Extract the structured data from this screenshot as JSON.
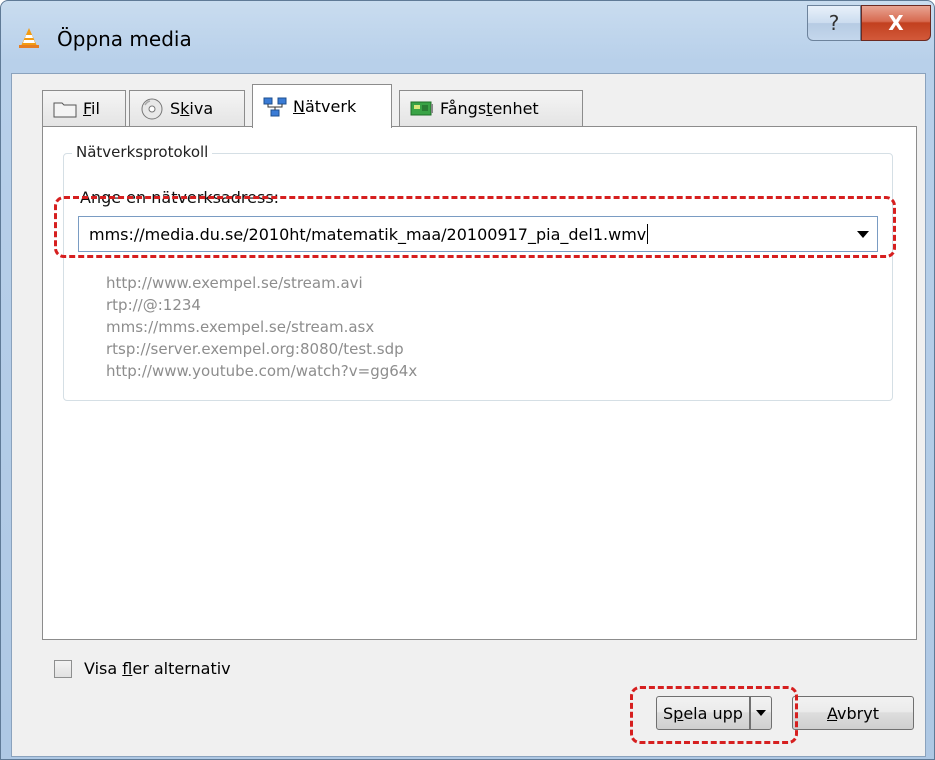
{
  "window": {
    "title": "Öppna media",
    "help_label": "?",
    "close_label": "X"
  },
  "tabs": [
    {
      "pre": "",
      "key": "F",
      "post": "il",
      "icon": "folder-icon"
    },
    {
      "pre": "S",
      "key": "k",
      "post": "iva",
      "icon": "disc-icon"
    },
    {
      "pre": "",
      "key": "N",
      "post": "ätverk",
      "icon": "network-icon"
    },
    {
      "pre": "Fångs",
      "key": "t",
      "post": "enhet",
      "icon": "capture-card-icon"
    }
  ],
  "active_tab": "Nätverk",
  "network": {
    "group_title": "Nätverksprotokoll",
    "address_label": "Ange en nätverksadress:",
    "address_value": "mms://media.du.se/2010ht/matematik_maa/20100917_pia_del1.wmv",
    "examples": [
      "http://www.exempel.se/stream.avi",
      "rtp://@:1234",
      "mms://mms.exempel.se/stream.asx",
      "rtsp://server.exempel.org:8080/test.sdp",
      "http://www.youtube.com/watch?v=gg64x"
    ]
  },
  "options": {
    "more_pre": "Visa ",
    "more_key": "f",
    "more_post": "ler alternativ",
    "more_checked": false
  },
  "buttons": {
    "play_pre": "S",
    "play_key": "p",
    "play_post": "ela upp",
    "cancel_key": "A",
    "cancel_post": "vbryt"
  },
  "colors": {
    "highlight_dash": "#d61f1f",
    "example_text": "#8d8d8d"
  }
}
